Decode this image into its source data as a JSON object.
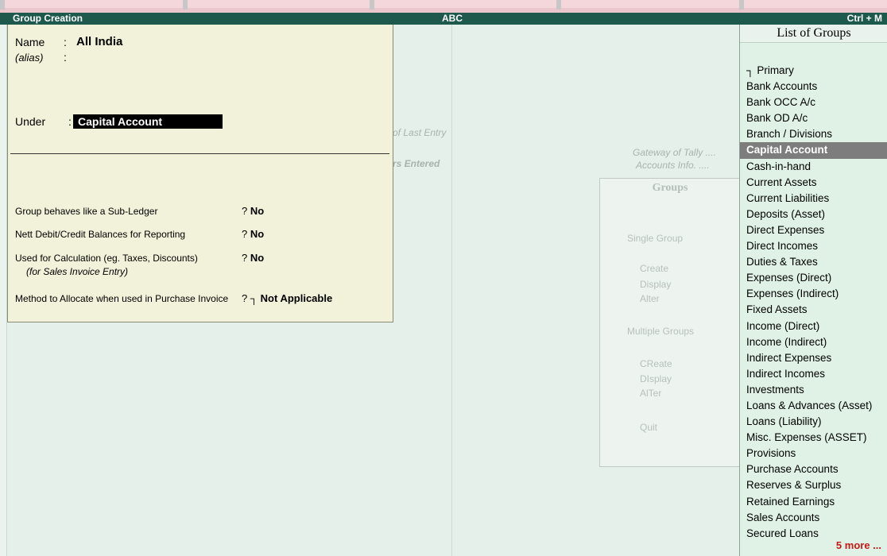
{
  "app": {
    "screen_title": "Group Creation",
    "company": "ABC",
    "shortcut": "Ctrl + M"
  },
  "form": {
    "name_label": "Name",
    "name_value": "All India",
    "alias_label": "(alias)",
    "alias_value": "",
    "under_label": "Under",
    "under_value": "Capital Account",
    "questions": [
      {
        "label": "Group behaves like a Sub-Ledger",
        "answer": "No"
      },
      {
        "label": "Nett Debit/Credit Balances for Reporting",
        "answer": "No"
      },
      {
        "label": "Used for Calculation (eg. Taxes, Discounts)",
        "sub": "(for Sales Invoice Entry)",
        "answer": "No"
      },
      {
        "label": "Method to Allocate when used in Purchase Invoice",
        "answer": "Not Applicable"
      }
    ]
  },
  "background": {
    "last_entry": "of Last Entry",
    "entered": "rs Entered",
    "gateway": "Gateway of Tally ....",
    "accounts_info": "Accounts Info. ....",
    "groups_title": "Groups",
    "single_group": "Single Group",
    "single_items": [
      "Create",
      "Display",
      "Alter"
    ],
    "multiple_groups": "Multiple Groups",
    "multiple_items": [
      "CReate",
      "DIsplay",
      "AlTer"
    ],
    "quit": "Quit"
  },
  "list_of_groups": {
    "title": "List of Groups",
    "items": [
      "┐ Primary",
      "Bank Accounts",
      "Bank OCC A/c",
      "Bank OD A/c",
      "Branch / Divisions",
      "Capital Account",
      "Cash-in-hand",
      "Current Assets",
      "Current Liabilities",
      "Deposits (Asset)",
      "Direct Expenses",
      "Direct Incomes",
      "Duties & Taxes",
      "Expenses (Direct)",
      "Expenses (Indirect)",
      "Fixed Assets",
      "Income (Direct)",
      "Income (Indirect)",
      "Indirect Expenses",
      "Indirect Incomes",
      "Investments",
      "Loans & Advances (Asset)",
      "Loans (Liability)",
      "Misc. Expenses (ASSET)",
      "Provisions",
      "Purchase Accounts",
      "Reserves & Surplus",
      "Retained Earnings",
      "Sales Accounts",
      "Secured Loans"
    ],
    "selected": "Capital Account",
    "more": "5 more ..."
  }
}
